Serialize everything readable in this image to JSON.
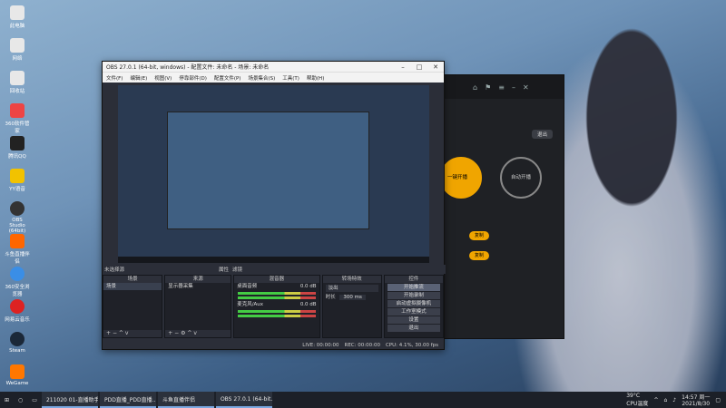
{
  "desktop_icons": [
    "此电脑",
    "网络",
    "回收站",
    "360软件管家",
    "腾讯QQ",
    "YY语音",
    "OBS Studio (64bit)",
    "斗鱼直播伴侣",
    "360安全浏览器",
    "网易云音乐",
    "Steam",
    "WeGame"
  ],
  "obs": {
    "title": "OBS 27.0.1 (64-bit, windows) - 配置文件: 未命名 - 场景: 未命名",
    "menu": [
      "文件(F)",
      "编辑(E)",
      "视图(V)",
      "停靠部件(D)",
      "配置文件(P)",
      "场景集合(S)",
      "工具(T)",
      "帮助(H)"
    ],
    "scene_bar": "未选择源",
    "scene_props": "属性",
    "scene_filter": "滤镜",
    "docks": {
      "scenes": {
        "header": "场景",
        "items": [
          "场景"
        ]
      },
      "sources": {
        "header": "来源",
        "items": [
          "显示器采集"
        ]
      },
      "mixer": {
        "header": "混音器",
        "tracks": [
          {
            "name": "桌面音频",
            "db": "0.0 dB"
          },
          {
            "name": "麦克风/Aux",
            "db": "0.0 dB"
          }
        ]
      },
      "transitions": {
        "header": "转场特效",
        "type": "淡出",
        "duration_label": "时长",
        "duration": "300 ms"
      },
      "controls": {
        "header": "控件",
        "buttons": [
          "开始推流",
          "开始录制",
          "启动虚拟摄像机",
          "工作室模式",
          "设置",
          "退出"
        ]
      }
    },
    "status": {
      "live": "LIVE: 00:00:00",
      "rec": "REC: 00:00:00",
      "cpu": "CPU: 4.1%, 30.00 fps"
    }
  },
  "side_app": {
    "stop_label": "退出",
    "tag1": "一键开播",
    "tag2": "自动开播",
    "link": "复制",
    "link2": "复制"
  },
  "taskbar": {
    "tasks": [
      "211020 01-直播助手",
      "PDD直播_PDD直播...",
      "斗鱼直播伴侣",
      "OBS 27.0.1 (64-bit..."
    ],
    "temp": "39°C",
    "temp_label": "CPU温度",
    "time": "14:57 周一",
    "date": "2021/8/30"
  },
  "colors": {
    "accent": "#f0a500",
    "obs_bg": "#2b2e38",
    "taskbar": "#1c2028"
  }
}
